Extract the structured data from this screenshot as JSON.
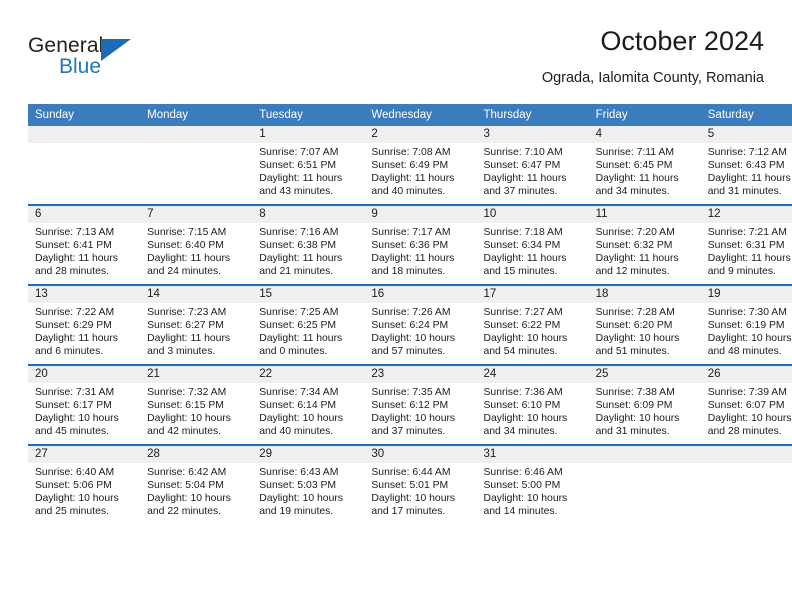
{
  "brand": {
    "name_part1": "General",
    "name_part2": "Blue",
    "triangle_icon": "triangle-icon",
    "accent_color": "#1b6cb5"
  },
  "header": {
    "title": "October 2024",
    "subtitle": "Ograda, Ialomita County, Romania"
  },
  "calendar": {
    "header_color": "#3a7cbe",
    "row_separator_color": "#1d6cb2",
    "daynum_band_color": "#efefef",
    "weekday_headers": [
      "Sunday",
      "Monday",
      "Tuesday",
      "Wednesday",
      "Thursday",
      "Friday",
      "Saturday"
    ],
    "weeks": [
      [
        {
          "day": "",
          "sunrise": "",
          "sunset": "",
          "daylight_line1": "",
          "daylight_line2": ""
        },
        {
          "day": "",
          "sunrise": "",
          "sunset": "",
          "daylight_line1": "",
          "daylight_line2": ""
        },
        {
          "day": "1",
          "sunrise": "Sunrise: 7:07 AM",
          "sunset": "Sunset: 6:51 PM",
          "daylight_line1": "Daylight: 11 hours",
          "daylight_line2": "and 43 minutes."
        },
        {
          "day": "2",
          "sunrise": "Sunrise: 7:08 AM",
          "sunset": "Sunset: 6:49 PM",
          "daylight_line1": "Daylight: 11 hours",
          "daylight_line2": "and 40 minutes."
        },
        {
          "day": "3",
          "sunrise": "Sunrise: 7:10 AM",
          "sunset": "Sunset: 6:47 PM",
          "daylight_line1": "Daylight: 11 hours",
          "daylight_line2": "and 37 minutes."
        },
        {
          "day": "4",
          "sunrise": "Sunrise: 7:11 AM",
          "sunset": "Sunset: 6:45 PM",
          "daylight_line1": "Daylight: 11 hours",
          "daylight_line2": "and 34 minutes."
        },
        {
          "day": "5",
          "sunrise": "Sunrise: 7:12 AM",
          "sunset": "Sunset: 6:43 PM",
          "daylight_line1": "Daylight: 11 hours",
          "daylight_line2": "and 31 minutes."
        }
      ],
      [
        {
          "day": "6",
          "sunrise": "Sunrise: 7:13 AM",
          "sunset": "Sunset: 6:41 PM",
          "daylight_line1": "Daylight: 11 hours",
          "daylight_line2": "and 28 minutes."
        },
        {
          "day": "7",
          "sunrise": "Sunrise: 7:15 AM",
          "sunset": "Sunset: 6:40 PM",
          "daylight_line1": "Daylight: 11 hours",
          "daylight_line2": "and 24 minutes."
        },
        {
          "day": "8",
          "sunrise": "Sunrise: 7:16 AM",
          "sunset": "Sunset: 6:38 PM",
          "daylight_line1": "Daylight: 11 hours",
          "daylight_line2": "and 21 minutes."
        },
        {
          "day": "9",
          "sunrise": "Sunrise: 7:17 AM",
          "sunset": "Sunset: 6:36 PM",
          "daylight_line1": "Daylight: 11 hours",
          "daylight_line2": "and 18 minutes."
        },
        {
          "day": "10",
          "sunrise": "Sunrise: 7:18 AM",
          "sunset": "Sunset: 6:34 PM",
          "daylight_line1": "Daylight: 11 hours",
          "daylight_line2": "and 15 minutes."
        },
        {
          "day": "11",
          "sunrise": "Sunrise: 7:20 AM",
          "sunset": "Sunset: 6:32 PM",
          "daylight_line1": "Daylight: 11 hours",
          "daylight_line2": "and 12 minutes."
        },
        {
          "day": "12",
          "sunrise": "Sunrise: 7:21 AM",
          "sunset": "Sunset: 6:31 PM",
          "daylight_line1": "Daylight: 11 hours",
          "daylight_line2": "and 9 minutes."
        }
      ],
      [
        {
          "day": "13",
          "sunrise": "Sunrise: 7:22 AM",
          "sunset": "Sunset: 6:29 PM",
          "daylight_line1": "Daylight: 11 hours",
          "daylight_line2": "and 6 minutes."
        },
        {
          "day": "14",
          "sunrise": "Sunrise: 7:23 AM",
          "sunset": "Sunset: 6:27 PM",
          "daylight_line1": "Daylight: 11 hours",
          "daylight_line2": "and 3 minutes."
        },
        {
          "day": "15",
          "sunrise": "Sunrise: 7:25 AM",
          "sunset": "Sunset: 6:25 PM",
          "daylight_line1": "Daylight: 11 hours",
          "daylight_line2": "and 0 minutes."
        },
        {
          "day": "16",
          "sunrise": "Sunrise: 7:26 AM",
          "sunset": "Sunset: 6:24 PM",
          "daylight_line1": "Daylight: 10 hours",
          "daylight_line2": "and 57 minutes."
        },
        {
          "day": "17",
          "sunrise": "Sunrise: 7:27 AM",
          "sunset": "Sunset: 6:22 PM",
          "daylight_line1": "Daylight: 10 hours",
          "daylight_line2": "and 54 minutes."
        },
        {
          "day": "18",
          "sunrise": "Sunrise: 7:28 AM",
          "sunset": "Sunset: 6:20 PM",
          "daylight_line1": "Daylight: 10 hours",
          "daylight_line2": "and 51 minutes."
        },
        {
          "day": "19",
          "sunrise": "Sunrise: 7:30 AM",
          "sunset": "Sunset: 6:19 PM",
          "daylight_line1": "Daylight: 10 hours",
          "daylight_line2": "and 48 minutes."
        }
      ],
      [
        {
          "day": "20",
          "sunrise": "Sunrise: 7:31 AM",
          "sunset": "Sunset: 6:17 PM",
          "daylight_line1": "Daylight: 10 hours",
          "daylight_line2": "and 45 minutes."
        },
        {
          "day": "21",
          "sunrise": "Sunrise: 7:32 AM",
          "sunset": "Sunset: 6:15 PM",
          "daylight_line1": "Daylight: 10 hours",
          "daylight_line2": "and 42 minutes."
        },
        {
          "day": "22",
          "sunrise": "Sunrise: 7:34 AM",
          "sunset": "Sunset: 6:14 PM",
          "daylight_line1": "Daylight: 10 hours",
          "daylight_line2": "and 40 minutes."
        },
        {
          "day": "23",
          "sunrise": "Sunrise: 7:35 AM",
          "sunset": "Sunset: 6:12 PM",
          "daylight_line1": "Daylight: 10 hours",
          "daylight_line2": "and 37 minutes."
        },
        {
          "day": "24",
          "sunrise": "Sunrise: 7:36 AM",
          "sunset": "Sunset: 6:10 PM",
          "daylight_line1": "Daylight: 10 hours",
          "daylight_line2": "and 34 minutes."
        },
        {
          "day": "25",
          "sunrise": "Sunrise: 7:38 AM",
          "sunset": "Sunset: 6:09 PM",
          "daylight_line1": "Daylight: 10 hours",
          "daylight_line2": "and 31 minutes."
        },
        {
          "day": "26",
          "sunrise": "Sunrise: 7:39 AM",
          "sunset": "Sunset: 6:07 PM",
          "daylight_line1": "Daylight: 10 hours",
          "daylight_line2": "and 28 minutes."
        }
      ],
      [
        {
          "day": "27",
          "sunrise": "Sunrise: 6:40 AM",
          "sunset": "Sunset: 5:06 PM",
          "daylight_line1": "Daylight: 10 hours",
          "daylight_line2": "and 25 minutes."
        },
        {
          "day": "28",
          "sunrise": "Sunrise: 6:42 AM",
          "sunset": "Sunset: 5:04 PM",
          "daylight_line1": "Daylight: 10 hours",
          "daylight_line2": "and 22 minutes."
        },
        {
          "day": "29",
          "sunrise": "Sunrise: 6:43 AM",
          "sunset": "Sunset: 5:03 PM",
          "daylight_line1": "Daylight: 10 hours",
          "daylight_line2": "and 19 minutes."
        },
        {
          "day": "30",
          "sunrise": "Sunrise: 6:44 AM",
          "sunset": "Sunset: 5:01 PM",
          "daylight_line1": "Daylight: 10 hours",
          "daylight_line2": "and 17 minutes."
        },
        {
          "day": "31",
          "sunrise": "Sunrise: 6:46 AM",
          "sunset": "Sunset: 5:00 PM",
          "daylight_line1": "Daylight: 10 hours",
          "daylight_line2": "and 14 minutes."
        },
        {
          "day": "",
          "sunrise": "",
          "sunset": "",
          "daylight_line1": "",
          "daylight_line2": ""
        },
        {
          "day": "",
          "sunrise": "",
          "sunset": "",
          "daylight_line1": "",
          "daylight_line2": ""
        }
      ]
    ]
  }
}
